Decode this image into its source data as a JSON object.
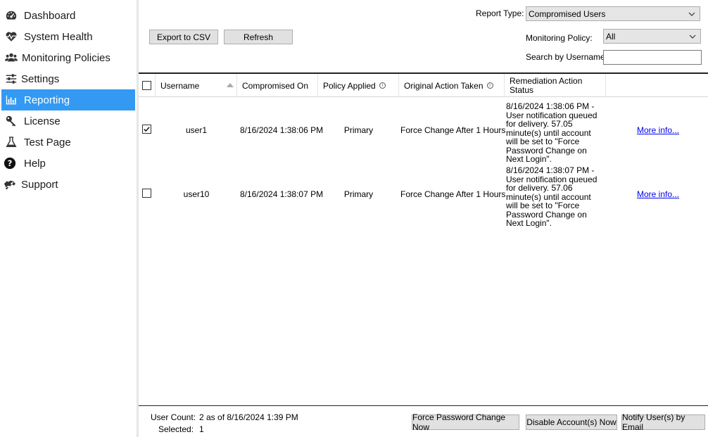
{
  "sidebar": {
    "items": [
      {
        "label": "Dashboard",
        "icon": "dashboard-gauge-icon",
        "active": false
      },
      {
        "label": "System Health",
        "icon": "heartbeat-icon",
        "active": false
      },
      {
        "label": "Monitoring Policies",
        "icon": "users-group-icon",
        "active": false
      },
      {
        "label": "Settings",
        "icon": "sliders-icon",
        "active": false
      },
      {
        "label": "Reporting",
        "icon": "bar-chart-icon",
        "active": true
      },
      {
        "label": "License",
        "icon": "key-icon",
        "active": false
      },
      {
        "label": "Test Page",
        "icon": "flask-icon",
        "active": false
      },
      {
        "label": "Help",
        "icon": "question-circle-icon",
        "active": false
      },
      {
        "label": "Support",
        "icon": "handshake-icon",
        "active": false
      }
    ],
    "active_color": "#3399f3"
  },
  "toolbar": {
    "export_label": "Export to CSV",
    "refresh_label": "Refresh"
  },
  "filters": {
    "report_type_label": "Report Type:",
    "report_type_value": "Compromised Users",
    "monitoring_policy_label": "Monitoring Policy:",
    "monitoring_policy_value": "All",
    "search_label": "Search by Username:",
    "search_value": ""
  },
  "grid": {
    "columns": {
      "username": "Username",
      "compromised_on": "Compromised On",
      "policy_applied": "Policy Applied",
      "original_action": "Original Action Taken",
      "remediation_status": "Remediation Action Status"
    },
    "rows": [
      {
        "checked": true,
        "username": "user1",
        "compromised_on": "8/16/2024 1:38:06 PM",
        "policy_applied": "Primary",
        "original_action": "Force Change After 1 Hours",
        "remediation_status": "8/16/2024 1:38:06 PM - User notification queued for delivery. 57.05 minute(s) until account will be set to \"Force Password Change on Next Login\".",
        "more_info": "More info..."
      },
      {
        "checked": false,
        "username": "user10",
        "compromised_on": "8/16/2024 1:38:07 PM",
        "policy_applied": "Primary",
        "original_action": "Force Change After 1 Hours",
        "remediation_status": "8/16/2024 1:38:07 PM - User notification queued for delivery. 57.06 minute(s) until account will be set to \"Force Password Change on Next Login\".",
        "more_info": "More info..."
      }
    ]
  },
  "footer": {
    "user_count_label": "User Count:",
    "user_count_value": "2 as of 8/16/2024 1:39 PM",
    "selected_label": "Selected:",
    "selected_value": "1",
    "force_password_label": "Force Password Change Now",
    "disable_accounts_label": "Disable Account(s) Now",
    "notify_users_label": "Notify User(s) by Email"
  }
}
